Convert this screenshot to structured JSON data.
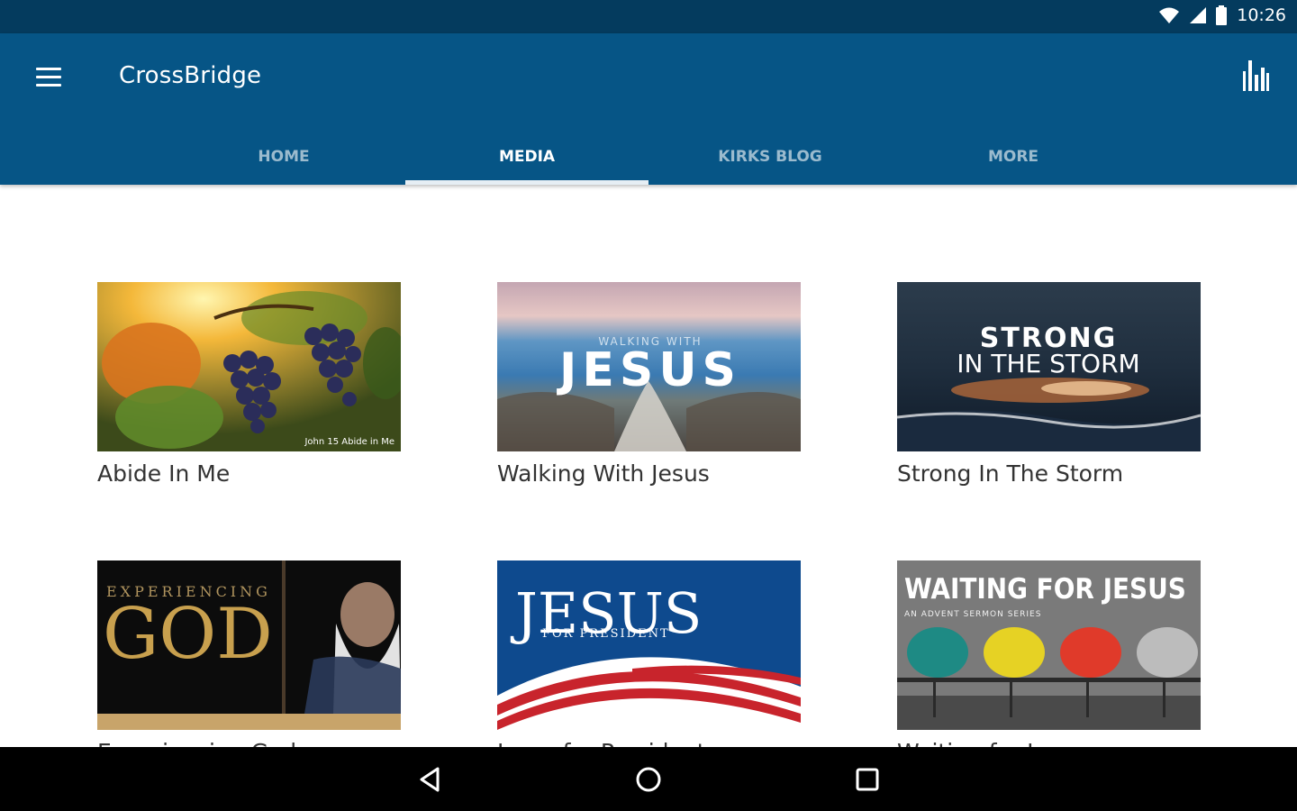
{
  "status": {
    "time": "10:26"
  },
  "app": {
    "title": "CrossBridge"
  },
  "tabs": [
    {
      "label": "HOME",
      "active": false
    },
    {
      "label": "MEDIA",
      "active": true
    },
    {
      "label": "KIRKS BLOG",
      "active": false
    },
    {
      "label": "MORE",
      "active": false
    }
  ],
  "media": [
    {
      "title": "Abide In Me",
      "art": {
        "caption": "John 15 Abide in Me"
      }
    },
    {
      "title": "Walking With Jesus",
      "art": {
        "small": "WALKING WITH",
        "big": "JESUS"
      }
    },
    {
      "title": "Strong In The Storm",
      "art": {
        "line1": "STRONG",
        "line2": "IN THE STORM"
      }
    },
    {
      "title": "Experiencing God",
      "art": {
        "line1": "EXPERIENCING",
        "line2": "GOD"
      }
    },
    {
      "title": "Jesus for President",
      "art": {
        "big": "JESUS",
        "small": "FOR PRESIDENT"
      }
    },
    {
      "title": "Waiting for Jesus",
      "art": {
        "line1": "WAITING FOR JESUS",
        "line2": "AN ADVENT SERMON SERIES"
      }
    }
  ],
  "colors": {
    "status_bar": "#043b5e",
    "app_bar": "#065586",
    "tab_indicator": "#e6eef4"
  }
}
